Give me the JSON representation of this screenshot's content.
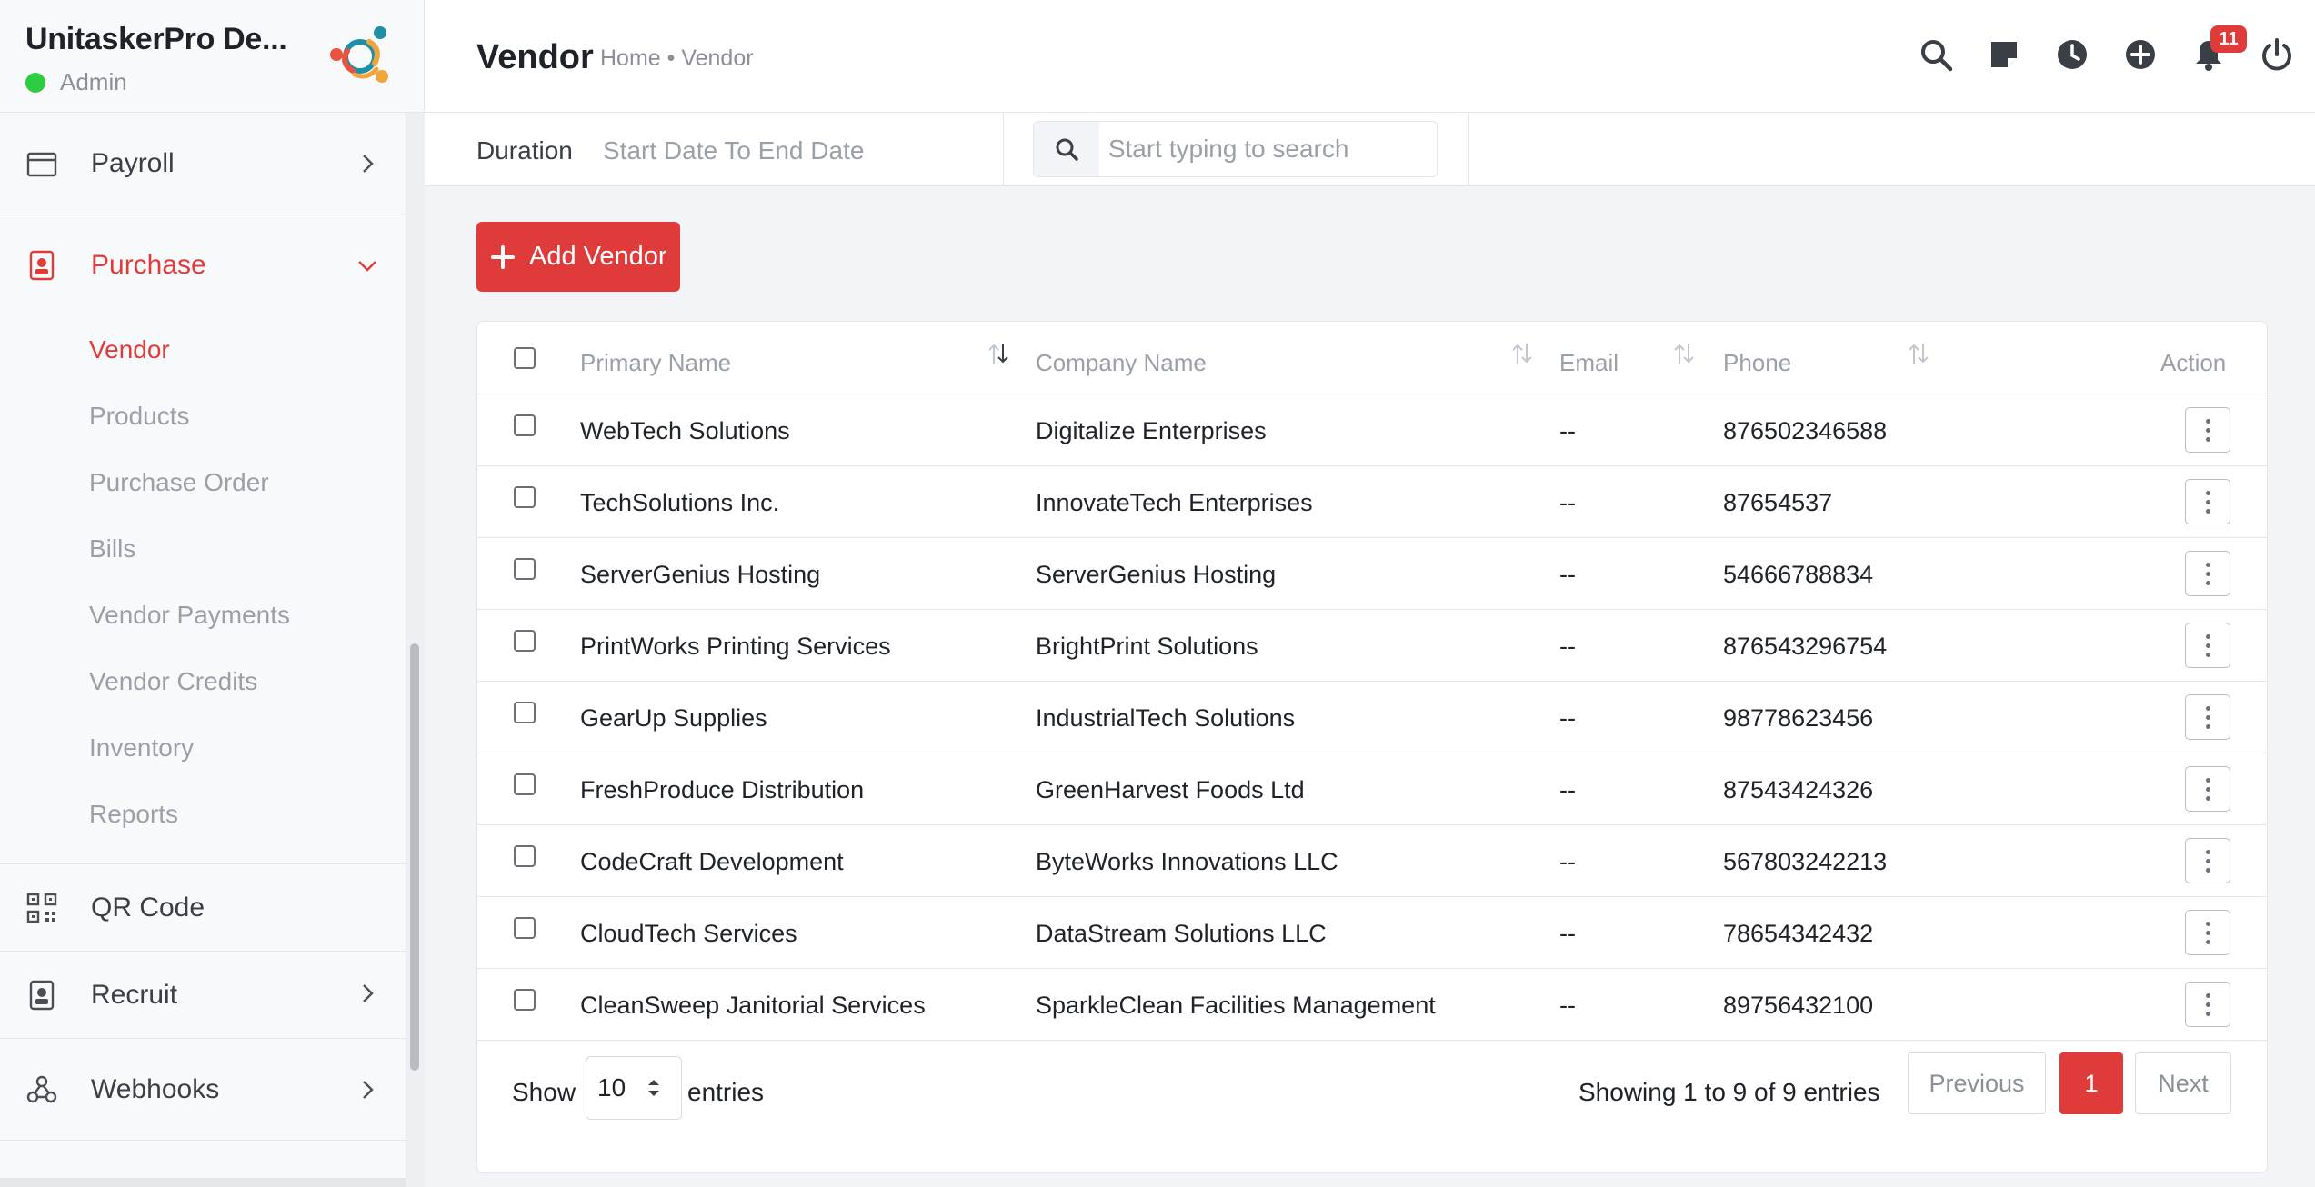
{
  "app": {
    "title": "UnitaskerPro De...",
    "role": "Admin"
  },
  "sidebar": {
    "items": [
      {
        "label": "Payroll",
        "icon": "wallet-icon"
      },
      {
        "label": "Purchase",
        "icon": "purchase-icon"
      }
    ],
    "purchase_sub": [
      "Vendor",
      "Products",
      "Purchase Order",
      "Bills",
      "Vendor Payments",
      "Vendor Credits",
      "Inventory",
      "Reports"
    ],
    "lower_items": [
      {
        "label": "QR Code",
        "icon": "qr-code-icon"
      },
      {
        "label": "Recruit",
        "icon": "recruit-icon"
      },
      {
        "label": "Webhooks",
        "icon": "webhooks-icon"
      }
    ]
  },
  "header": {
    "title": "Vendor",
    "breadcrumb": "Home • Vendor",
    "notification_count": "11"
  },
  "filters": {
    "duration_label": "Duration",
    "duration_value": "Start Date To End Date",
    "search_placeholder": "Start typing to search"
  },
  "actions": {
    "add_label": "Add Vendor"
  },
  "table": {
    "columns": [
      "Primary Name",
      "Company Name",
      "Email",
      "Phone",
      "Action"
    ],
    "rows": [
      {
        "primary": "WebTech Solutions",
        "company": "Digitalize Enterprises",
        "email": "--",
        "phone": "876502346588"
      },
      {
        "primary": "TechSolutions Inc.",
        "company": "InnovateTech Enterprises",
        "email": "--",
        "phone": "87654537"
      },
      {
        "primary": "ServerGenius Hosting",
        "company": "ServerGenius Hosting",
        "email": "--",
        "phone": "54666788834"
      },
      {
        "primary": "PrintWorks Printing Services",
        "company": "BrightPrint Solutions",
        "email": "--",
        "phone": "876543296754"
      },
      {
        "primary": "GearUp Supplies",
        "company": "IndustrialTech Solutions",
        "email": "--",
        "phone": "98778623456"
      },
      {
        "primary": "FreshProduce Distribution",
        "company": "GreenHarvest Foods Ltd",
        "email": "--",
        "phone": "87543424326"
      },
      {
        "primary": "CodeCraft Development",
        "company": "ByteWorks Innovations LLC",
        "email": "--",
        "phone": "567803242213"
      },
      {
        "primary": "CloudTech Services",
        "company": "DataStream Solutions LLC",
        "email": "--",
        "phone": "78654342432"
      },
      {
        "primary": "CleanSweep Janitorial Services",
        "company": "SparkleClean Facilities Management",
        "email": "--",
        "phone": "89756432100"
      }
    ]
  },
  "pagination": {
    "show_label": "Show",
    "page_size": "10",
    "entries_label": "entries",
    "summary": "Showing 1 to 9 of 9 entries",
    "prev": "Previous",
    "current": "1",
    "next": "Next"
  },
  "colors": {
    "accent": "#e03b3b",
    "online": "#2ecc40"
  }
}
